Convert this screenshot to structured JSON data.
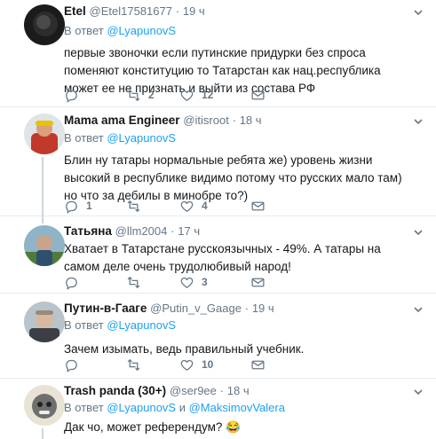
{
  "colors": {
    "accent": "#1da1f2",
    "muted": "#657786",
    "text": "#14171a",
    "divider": "#e6ecf0"
  },
  "icons": {
    "reply": "reply-icon",
    "retweet": "retweet-icon",
    "like": "like-icon",
    "dm": "dm-icon",
    "more": "chevron-down-icon"
  },
  "tweets": [
    {
      "name": "Etel",
      "handle": "@Etel17581677",
      "time": "19 ч",
      "reply_prefix": "В ответ",
      "reply_to": "@LyapunovS",
      "text": "первые звоночки если путинские придурки без спроса поменяют конституцию то Татарстан как нац.республика может ее не признать и выйти из состава РФ",
      "counts": {
        "reply": "",
        "retweet": "2",
        "like": "12"
      }
    },
    {
      "name": "Mama ama Engineer",
      "handle": "@itisroot",
      "time": "18 ч",
      "reply_prefix": "В ответ",
      "reply_to": "@LyapunovS",
      "text": "Блин ну татары нормальные ребята же) уровень жизни высокий в республике видимо потому что русских мало там) но что за дебилы в минобре то?)",
      "counts": {
        "reply": "1",
        "retweet": "",
        "like": "4"
      }
    },
    {
      "name": "Татьяна",
      "handle": "@llm2004",
      "time": "17 ч",
      "text": "Хватает в Татарстане русскоязычных - 49%. А татары на самом деле очень трудолюбивый народ!",
      "counts": {
        "reply": "",
        "retweet": "",
        "like": "3"
      }
    },
    {
      "name": "Путин-в-Гааге",
      "handle": "@Putin_v_Gaage",
      "time": "19 ч",
      "reply_prefix": "В ответ",
      "reply_to": "@LyapunovS",
      "text": "Зачем изымать, ведь правильный учебник.",
      "counts": {
        "reply": "",
        "retweet": "",
        "like": "10"
      }
    },
    {
      "name": "Trash panda (30+)",
      "handle": "@ser9ee",
      "time": "18 ч",
      "reply_prefix": "В ответ",
      "reply_to": "@LyapunovS",
      "reply_and": "и",
      "reply_to2": "@MaksimovValera",
      "text": "Дак чо, может референдум? 😂"
    }
  ]
}
